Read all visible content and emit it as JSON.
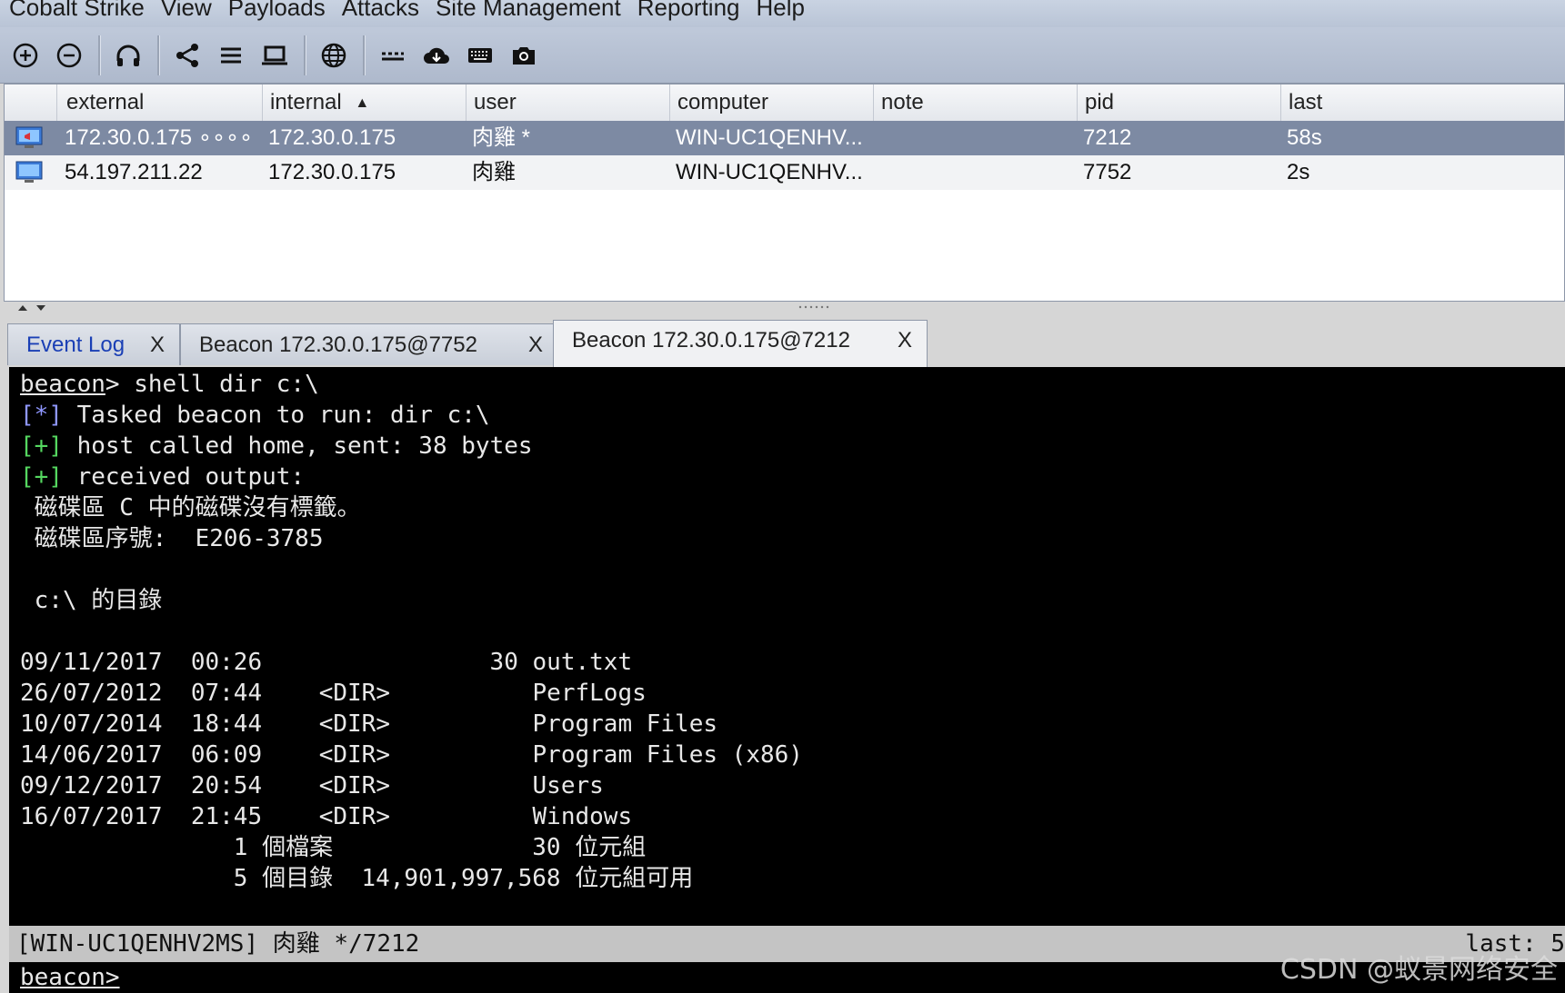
{
  "menu": [
    "Cobalt Strike",
    "View",
    "Payloads",
    "Attacks",
    "Site Management",
    "Reporting",
    "Help"
  ],
  "toolbar": {
    "icons": [
      "plus-circle-icon",
      "minus-circle-icon",
      "headphones-icon",
      "share-icon",
      "list-icon",
      "laptop-icon",
      "globe-icon",
      "dots-icon",
      "cloud-icon",
      "keyboard-icon",
      "camera-icon"
    ]
  },
  "table": {
    "columns": [
      "external",
      "internal",
      "user",
      "computer",
      "note",
      "pid",
      "last"
    ],
    "sort_indicator": "▲",
    "rows": [
      {
        "external": "172.30.0.175 ∘∘∘∘",
        "internal": "172.30.0.175",
        "user": "肉雞 *",
        "computer": "WIN-UC1QENHV...",
        "note": "",
        "pid": "7212",
        "last": "58s"
      },
      {
        "external": "54.197.211.22",
        "internal": "172.30.0.175",
        "user": "肉雞",
        "computer": "WIN-UC1QENHV...",
        "note": "",
        "pid": "7752",
        "last": "2s"
      }
    ]
  },
  "tabs": [
    {
      "label": "Event Log",
      "close": "X"
    },
    {
      "label": "Beacon 172.30.0.175@7752",
      "close": "X"
    },
    {
      "label": "Beacon 172.30.0.175@7212",
      "close": "X"
    }
  ],
  "console": {
    "prompt_word": "beacon",
    "cmd": "> shell dir c:\\",
    "l1_tag": "[*]",
    "l1": " Tasked beacon to run: dir c:\\",
    "l2_tag": "[+]",
    "l2": " host called home, sent: 38 bytes",
    "l3_tag": "[+]",
    "l3": " received output:",
    "l4": " 磁碟區 C 中的磁碟沒有標籤。",
    "l5": " 磁碟區序號:  E206-3785",
    "l6": " c:\\ 的目錄",
    "dir_lines": [
      "09/11/2017  00:26                30 out.txt",
      "26/07/2012  07:44    <DIR>          PerfLogs",
      "10/07/2014  18:44    <DIR>          Program Files",
      "14/06/2017  06:09    <DIR>          Program Files (x86)",
      "09/12/2017  20:54    <DIR>          Users",
      "16/07/2017  21:45    <DIR>          Windows",
      "               1 個檔案              30 位元組",
      "               5 個目錄  14,901,997,568 位元組可用"
    ]
  },
  "status": {
    "left": "[WIN-UC1QENHV2MS] 肉雞 */7212",
    "right": "last: 5"
  },
  "prompt": "beacon>",
  "watermark": "CSDN @蚁景网络安全"
}
